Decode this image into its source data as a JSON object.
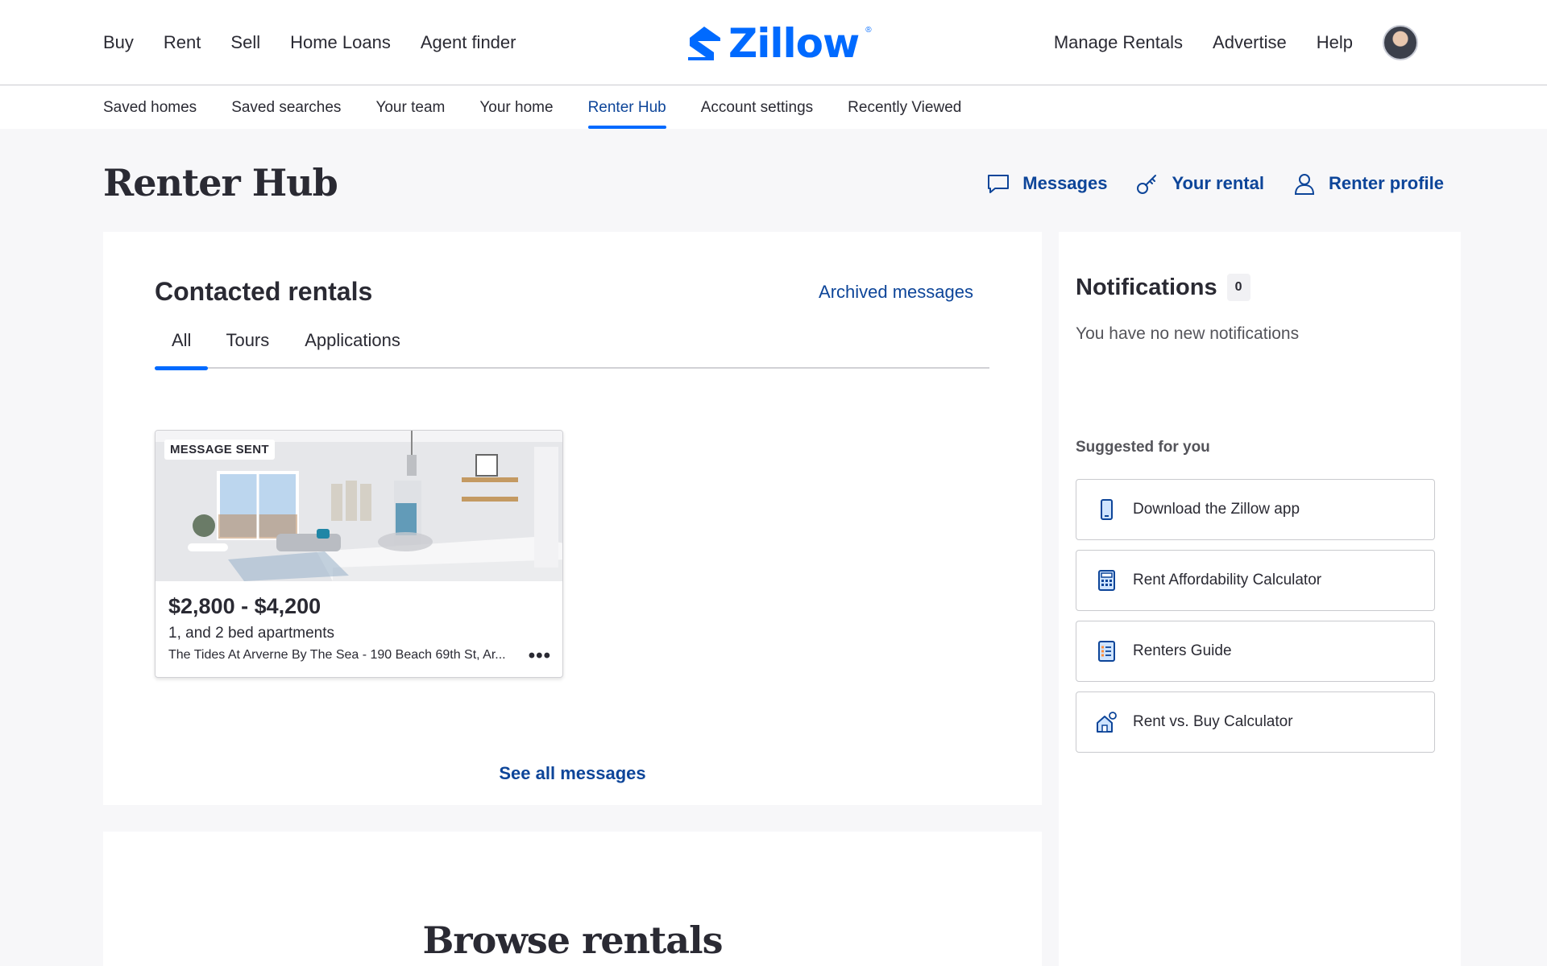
{
  "header": {
    "nav_left": [
      "Buy",
      "Rent",
      "Sell",
      "Home Loans",
      "Agent finder"
    ],
    "logo_text": "Zillow",
    "logo_reg": "®",
    "nav_right": [
      "Manage Rentals",
      "Advertise",
      "Help"
    ]
  },
  "subnav": {
    "items": [
      "Saved homes",
      "Saved searches",
      "Your team",
      "Your home",
      "Renter Hub",
      "Account settings",
      "Recently Viewed"
    ],
    "active": "Renter Hub"
  },
  "page": {
    "title": "Renter Hub",
    "quick_links": {
      "messages": "Messages",
      "your_rental": "Your rental",
      "renter_profile": "Renter profile"
    }
  },
  "contacted": {
    "title": "Contacted rentals",
    "archived_link": "Archived messages",
    "tabs": [
      "All",
      "Tours",
      "Applications"
    ],
    "active_tab": "All",
    "listing": {
      "badge": "MESSAGE SENT",
      "price": "$2,800 - $4,200",
      "beds": "1, and 2 bed apartments",
      "address": "The Tides At Arverne By The Sea - 190 Beach 69th St, Ar...",
      "more": "•••"
    },
    "see_all": "See all messages"
  },
  "browse": {
    "title": "Browse rentals"
  },
  "notifications": {
    "title": "Notifications",
    "count": "0",
    "empty_text": "You have no new notifications",
    "suggested_label": "Suggested for you",
    "suggestions": [
      {
        "label": "Download the Zillow app",
        "icon": "phone-icon"
      },
      {
        "label": "Rent Affordability Calculator",
        "icon": "calculator-icon"
      },
      {
        "label": "Renters Guide",
        "icon": "checklist-icon"
      },
      {
        "label": "Rent vs. Buy Calculator",
        "icon": "house-icon"
      }
    ]
  },
  "colors": {
    "brand_blue": "#006aff",
    "link_navy": "#0d4599",
    "text": "#2a2a33",
    "page_bg": "#f7f7f9"
  }
}
